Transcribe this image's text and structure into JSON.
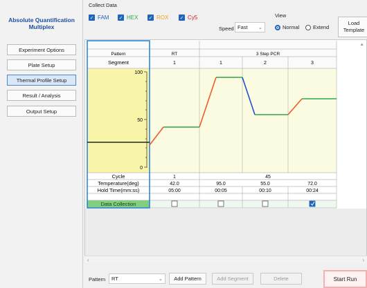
{
  "sidebar": {
    "title_line1": "Absolute Quantification",
    "title_line2": "Multiplex",
    "items": [
      {
        "label": "Experiment Options",
        "active": false
      },
      {
        "label": "Plate Setup",
        "active": false
      },
      {
        "label": "Thermal Profile Setup",
        "active": true
      },
      {
        "label": "Result / Analysis",
        "active": false
      },
      {
        "label": "Output Setup",
        "active": false
      }
    ]
  },
  "toolbar": {
    "collect_label": "Collect Data",
    "dyes": [
      {
        "label": "FAM",
        "color": "#1f64b9",
        "checked": true
      },
      {
        "label": "HEX",
        "color": "#2ea84a",
        "checked": true
      },
      {
        "label": "ROX",
        "color": "#f0a020",
        "checked": true
      },
      {
        "label": "Cy5",
        "color": "#d22020",
        "checked": true
      }
    ],
    "speed_label": "Speed",
    "speed_value": "Fast",
    "view_label": "View",
    "view_normal": "Normal",
    "view_extend": "Extend",
    "load_line1": "Load",
    "load_line2": "Template"
  },
  "table": {
    "pattern_header": "Pattern",
    "segment_header": "Segment",
    "patterns": [
      "RT",
      "3 Step PCR"
    ],
    "segments": [
      "1",
      "1",
      "2",
      "3"
    ],
    "cycle_label": "Cycle",
    "cycles": [
      "1",
      "45"
    ],
    "temp_label": "Temperature(deg)",
    "temps": [
      "42.0",
      "95.0",
      "55.0",
      "72.0"
    ],
    "hold_label": "Hold Time(mm:ss)",
    "holds": [
      "05:00",
      "00:05",
      "00:10",
      "00:24"
    ],
    "dc_label": "Data Collection",
    "dc_checked": [
      false,
      false,
      false,
      true
    ],
    "y_ticks": [
      "100",
      "50",
      "0"
    ]
  },
  "bottom": {
    "pattern_label": "Pattern",
    "pattern_value": "RT",
    "add_pattern": "Add Pattern",
    "add_segment": "Add Segment",
    "delete": "Delete",
    "start_run": "Start Run"
  },
  "colors": {
    "accent": "#1f64b9",
    "chart_bg": "#fbfbe2",
    "axis_bg": "#f9f5a8",
    "ramp": "#f05a28",
    "hold": "#2ea84a",
    "cool_ramp": "#1f50c8",
    "dc_bg": "#7fcf7f"
  }
}
